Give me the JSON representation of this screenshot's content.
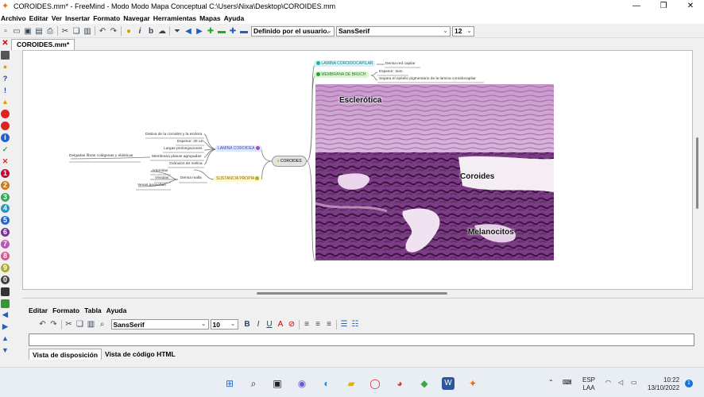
{
  "window": {
    "title": "COROIDES.mm* - FreeMind - Modo Modo Mapa Conceptual C:\\Users\\Nixa\\Desktop\\COROIDES.mm"
  },
  "menu": [
    "Archivo",
    "Editar",
    "Ver",
    "Insertar",
    "Formato",
    "Navegar",
    "Herramientas",
    "Mapas",
    "Ayuda"
  ],
  "toolbar": {
    "style_combo": "Definido por el usuario.",
    "font_combo": "SansSerif",
    "size_combo": "12"
  },
  "tab": {
    "label": "COROIDES.mm*"
  },
  "mindmap": {
    "root": "COROIDES",
    "lamina_coroidea": {
      "label": "LAMINA COROIDEA",
      "children": [
        "Distiva de la coroides y la esclera",
        "Espesor: 30 um",
        "Largas prolongaciones",
        "Membrana planas agrupadas",
        "Gránulos de melina"
      ],
      "sub": "Delgadas fibras colágenas y elásticas"
    },
    "sustancia_propia": {
      "label": "SUSTANCIA PROPIA",
      "child": "Densa malla",
      "grandchildren": [
        "Arteriolas",
        "Vénulas",
        "Venas pequeñas"
      ]
    },
    "lamina_coroidocapilar": {
      "label": "LAMINA COROIDOCAPILAR",
      "child": "Densa red capilar"
    },
    "membrana_bruch": {
      "label": "MEMBRANA DE BRUCH",
      "children": [
        "Espesor: 3um",
        "Separa el epitelio pigmentario de la lamina coroidocapilar"
      ]
    },
    "image_labels": {
      "sclera": "Esclerótica",
      "choroid": "Coroides",
      "melanocytes": "Melanocitos"
    }
  },
  "editor": {
    "menu": [
      "Editar",
      "Formato",
      "Tabla",
      "Ayuda"
    ],
    "font": "SansSerif",
    "size": "10",
    "tabs": [
      "Vista de disposición",
      "Vista de código HTML"
    ]
  },
  "taskbar": {
    "lang": "ESP",
    "lang2": "LAA",
    "time": "10:22",
    "date": "13/10/2022",
    "notification_count": "1"
  }
}
